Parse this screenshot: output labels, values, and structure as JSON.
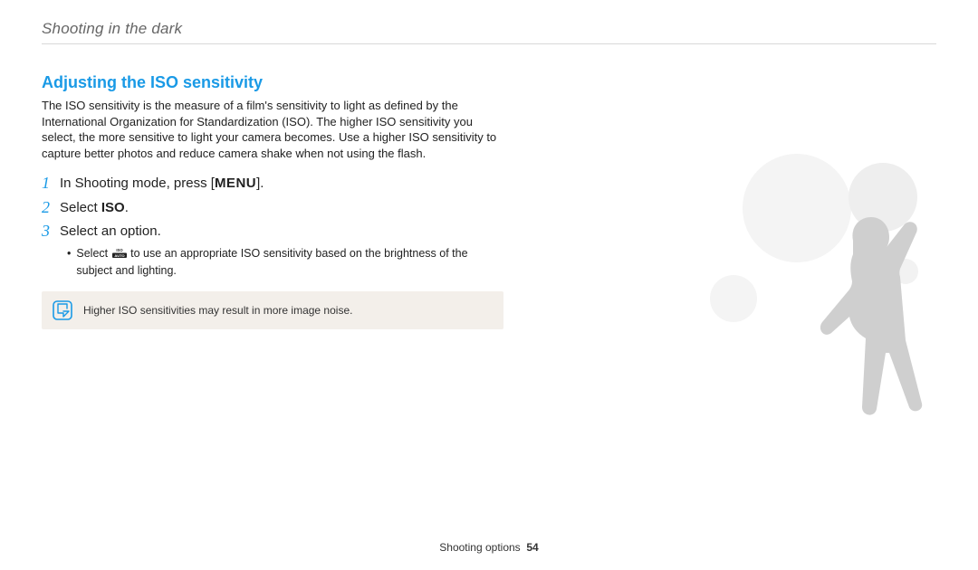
{
  "header": {
    "title": "Shooting in the dark"
  },
  "section": {
    "heading": "Adjusting the ISO sensitivity",
    "body": "The ISO sensitivity is the measure of a film's sensitivity to light as defined by the International Organization for Standardization (ISO). The higher ISO sensitivity you select, the more sensitive to light your camera becomes. Use a higher ISO sensitivity to capture better photos and reduce camera shake when not using the flash."
  },
  "steps": {
    "s1": {
      "num": "1",
      "pre": "In Shooting mode, press [",
      "menu": "MENU",
      "post": "]."
    },
    "s2": {
      "num": "2",
      "pre": "Select ",
      "bold": "ISO",
      "post": "."
    },
    "s3": {
      "num": "3",
      "text": "Select an option."
    },
    "s3_sub": {
      "pre": "Select ",
      "post": " to use an appropriate ISO sensitivity based on the brightness of the subject and lighting."
    }
  },
  "note": {
    "text": "Higher ISO sensitivities may result in more image noise."
  },
  "footer": {
    "label": "Shooting options",
    "page": "54"
  }
}
